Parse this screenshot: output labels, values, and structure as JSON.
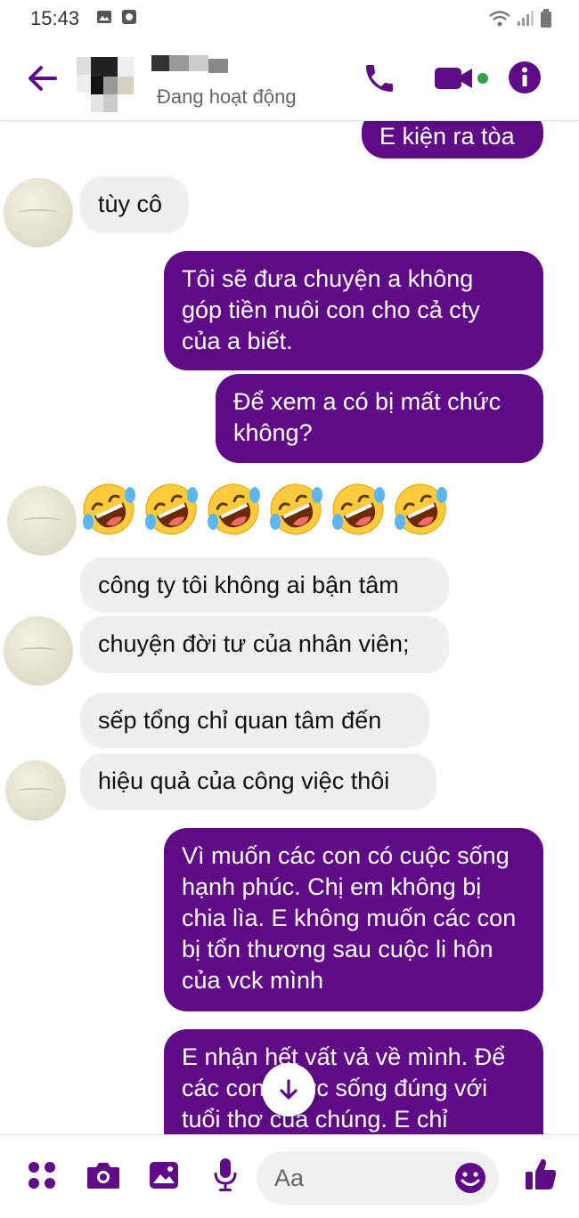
{
  "status_bar": {
    "time": "15:43"
  },
  "header": {
    "status": "Đang hoạt động"
  },
  "messages": [
    {
      "dir": "out",
      "text": "E kiện ra tòa"
    },
    {
      "dir": "in",
      "text": "tùy cô"
    },
    {
      "dir": "out",
      "text": "Tôi sẽ đưa chuyện a không góp tiền nuôi con cho cả cty của a biết."
    },
    {
      "dir": "out",
      "text": "Để xem a có bị mất chức không?"
    },
    {
      "dir": "in",
      "text": "🤣🤣🤣🤣🤣🤣"
    },
    {
      "dir": "in",
      "text": "công ty tôi không ai bận tâm"
    },
    {
      "dir": "in",
      "text": "chuyện đời tư của nhân viên;"
    },
    {
      "dir": "in",
      "text": "sếp tổng chỉ quan tâm đến"
    },
    {
      "dir": "in",
      "text": "hiệu quả của công việc thôi"
    },
    {
      "dir": "out",
      "text": "Vì muốn các con có cuộc sống hạnh phúc. Chị em không bị chia lìa. E không muốn các con bị tổn thương sau cuộc li hôn của vck mình"
    },
    {
      "dir": "out",
      "text": "E nhận hết vất vả về mình. Để các con được sống đúng với tuổi thơ của chúng. E chỉ"
    }
  ],
  "composer": {
    "placeholder": "Aa"
  },
  "colors": {
    "accent": "#5f0a87",
    "online": "#31a24c",
    "incoming_bubble": "#efefef"
  },
  "icons": [
    "back-arrow-icon",
    "phone-icon",
    "video-icon",
    "info-icon",
    "apps-icon",
    "camera-icon",
    "gallery-icon",
    "microphone-icon",
    "emoji-icon",
    "like-icon",
    "arrow-down-icon"
  ]
}
